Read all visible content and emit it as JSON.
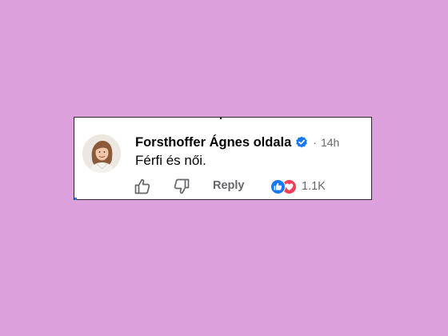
{
  "colors": {
    "page_background": "#dca0dc",
    "card_background": "#ffffff",
    "verified_blue": "#1877f2",
    "like_blue": "#1877f2",
    "love_red": "#f33e58",
    "secondary_text": "#65676b"
  },
  "comment": {
    "author": "Forsthoffer Ágnes oldala",
    "verified_icon": "verified-badge-icon",
    "separator": "·",
    "timestamp": "14h",
    "text": "Férfi és női.",
    "actions": {
      "like_icon": "thumbs-up-icon",
      "dislike_icon": "thumbs-down-icon",
      "reply_label": "Reply"
    },
    "reactions": {
      "icons": [
        "like-reaction-icon",
        "love-reaction-icon"
      ],
      "count": "1.1K"
    }
  }
}
